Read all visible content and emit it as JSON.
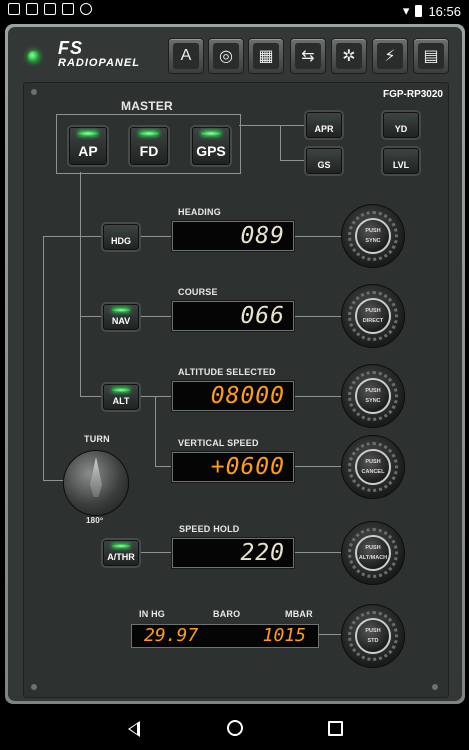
{
  "status_bar": {
    "time": "16:56",
    "icons": [
      "sim-icon",
      "gallery-icon",
      "gallery-icon",
      "calendar-icon",
      "usb-icon"
    ]
  },
  "logo": {
    "line1": "FS",
    "line2": "RADIOPANEL"
  },
  "toolbar": {
    "buttons": [
      "autopilot-icon",
      "radio-stack-icon",
      "engine-display-icon",
      "settings-sliders-icon",
      "gear-settings-icon",
      "tools-icon",
      "monitor-icon"
    ]
  },
  "model": "FGP-RP3020",
  "master": {
    "label": "MASTER",
    "buttons": [
      {
        "label": "AP",
        "on": true
      },
      {
        "label": "FD",
        "on": true
      },
      {
        "label": "GPS",
        "on": true
      }
    ]
  },
  "side_buttons": [
    {
      "label": "APR",
      "on": false
    },
    {
      "label": "YD",
      "on": false
    },
    {
      "label": "GS",
      "on": false
    },
    {
      "label": "LVL",
      "on": false
    }
  ],
  "modes": [
    {
      "button": "HDG",
      "button_on": false,
      "title": "HEADING",
      "value": "089",
      "color": "white",
      "knob_top": "PUSH",
      "knob_bottom": "SYNC"
    },
    {
      "button": "NAV",
      "button_on": true,
      "title": "COURSE",
      "value": "066",
      "color": "white",
      "knob_top": "PUSH",
      "knob_bottom": "DIRECT"
    },
    {
      "button": "ALT",
      "button_on": true,
      "title": "ALTITUDE SELECTED",
      "value": "08000",
      "color": "amber",
      "knob_top": "PUSH",
      "knob_bottom": "SYNC"
    },
    {
      "title": "VERTICAL SPEED",
      "value": "+0600",
      "color": "amber",
      "knob_top": "PUSH",
      "knob_bottom": "CANCEL"
    },
    {
      "button": "A/THR",
      "button_on": true,
      "title": "SPEED HOLD",
      "value": "220",
      "color": "white",
      "knob_top": "PUSH",
      "knob_bottom": "ALT/MACH"
    }
  ],
  "turn": {
    "label": "TURN",
    "degrees": "180º"
  },
  "baro": {
    "left": "IN HG",
    "center": "BARO",
    "right": "MBAR",
    "inhg": "29.97",
    "mbar": "1015",
    "knob_top": "PUSH",
    "knob_bottom": "STD"
  }
}
